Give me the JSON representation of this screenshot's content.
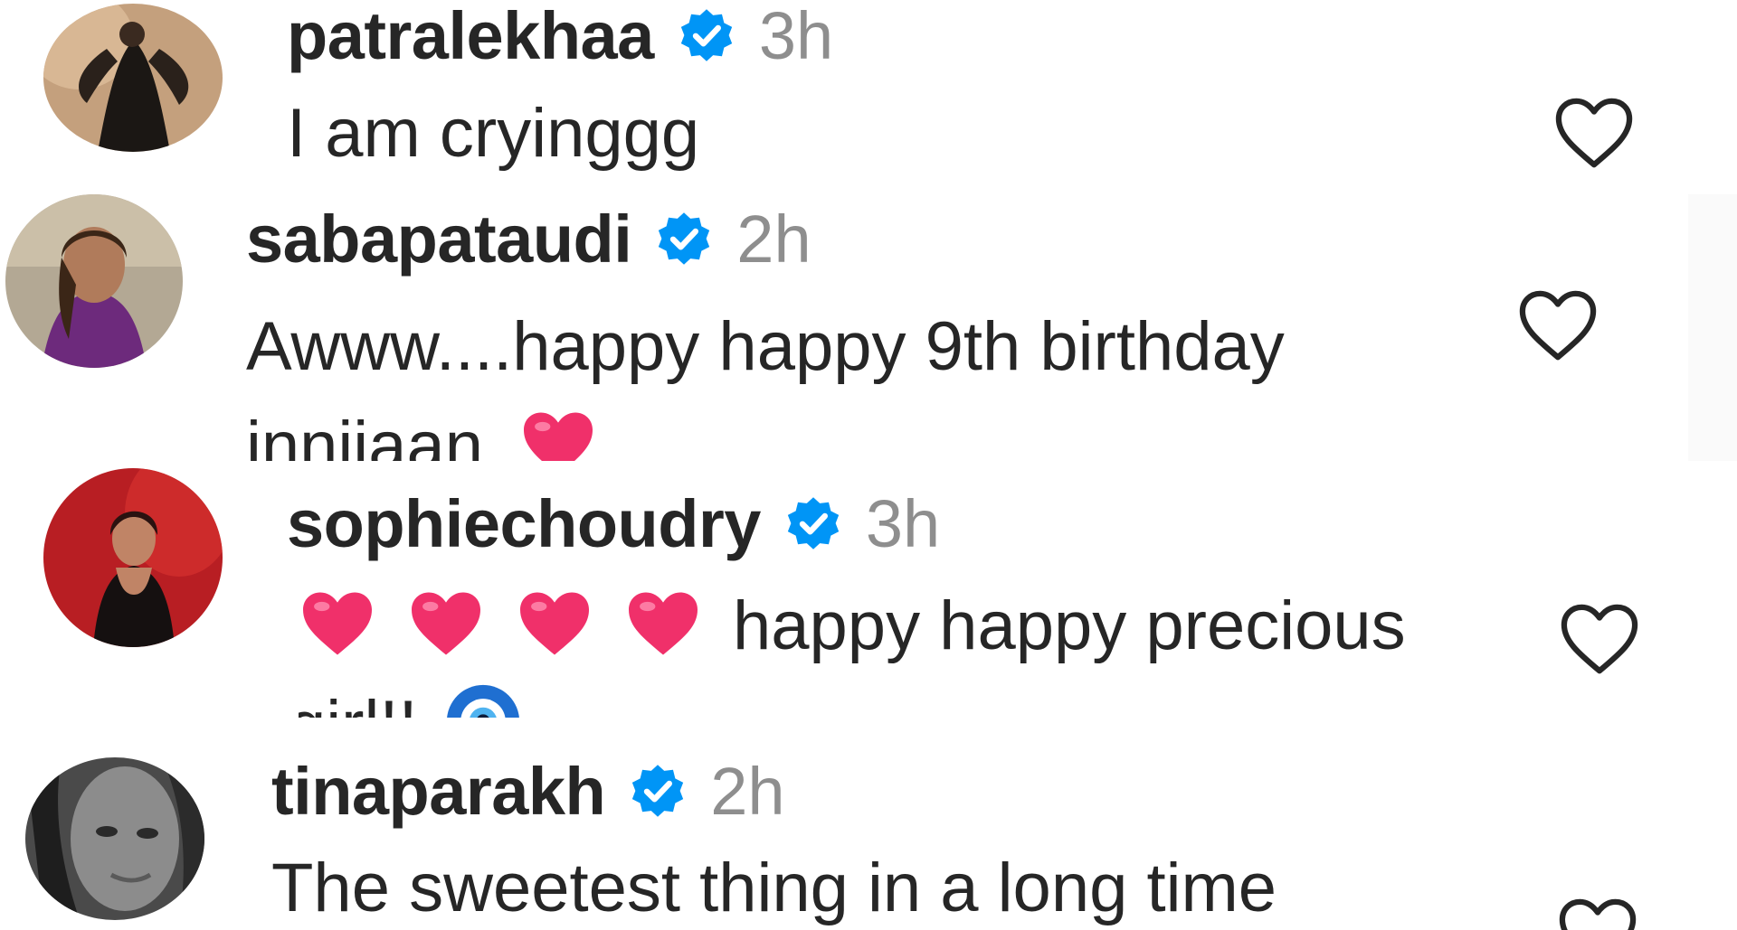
{
  "comments": [
    {
      "username": "patralekhaa",
      "time": "3h",
      "text": "I am cryinggg",
      "verified": true,
      "avatar_icon": "avatar-photo-dark-dress"
    },
    {
      "username": "sabapataudi",
      "time": "2h",
      "text_line1": "Awww....happy happy 9th birthday",
      "text_line2": "inniiaan",
      "trailing_emoji": "red-heart-emoji",
      "verified": true,
      "avatar_icon": "avatar-photo-woman-purple"
    },
    {
      "username": "sophiechoudry",
      "time": "3h",
      "leading_emoji": [
        "red-heart-emoji",
        "red-heart-emoji",
        "red-heart-emoji",
        "red-heart-emoji"
      ],
      "text_line1": "happy happy precious",
      "text_line2": "girl!!",
      "trailing_emoji": "nazar-amulet-emoji",
      "verified": true,
      "avatar_icon": "avatar-photo-red-background"
    },
    {
      "username": "tinaparakh",
      "time": "2h",
      "text": "The sweetest thing in a long time",
      "verified": true,
      "avatar_icon": "avatar-photo-black-white"
    }
  ],
  "colors": {
    "username": "#262626",
    "timestamp": "#8e8e8e",
    "verified_badge": "#0095f6",
    "heart_emoji": "#f0306a",
    "like_outline": "#262626"
  }
}
